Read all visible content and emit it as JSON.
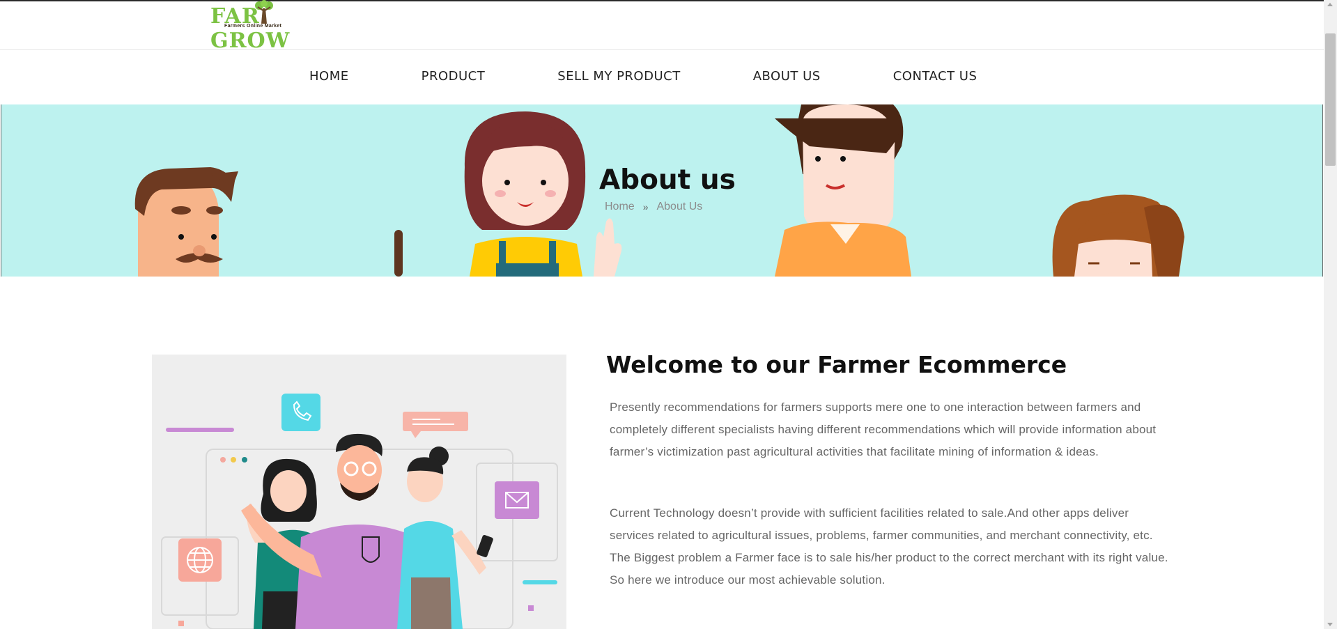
{
  "logo": {
    "text_left": "FAR",
    "text_right": "GROW",
    "tagline": "Farmers Online Market"
  },
  "nav": {
    "items": [
      {
        "label": "HOME"
      },
      {
        "label": "PRODUCT"
      },
      {
        "label": "SELL MY PRODUCT"
      },
      {
        "label": "ABOUT US"
      },
      {
        "label": "CONTACT US"
      }
    ]
  },
  "banner": {
    "title": "About us",
    "breadcrumb": {
      "home": "Home",
      "separator": "»",
      "current": "About Us"
    }
  },
  "content": {
    "heading": "Welcome to our Farmer Ecommerce",
    "paragraphs": [
      "Presently recommendations for farmers supports mere one to one interaction between farmers and completely different specialists having different recommendations which will provide information about farmer’s victimization past agricultural activities that facilitate mining of information & ideas.",
      "Current Technology doesn’t provide with sufficient facilities related to sale.And other apps deliver services related to agricultural issues, problems, farmer communities, and merchant connectivity, etc. The Biggest problem a Farmer face is to sale his/her product to the correct merchant with its right value. So here we introduce our most achievable solution."
    ]
  },
  "colors": {
    "banner_bg": "#bdf2ef",
    "logo_green": "#7cc243",
    "illustration_bg": "#eeeeee"
  }
}
